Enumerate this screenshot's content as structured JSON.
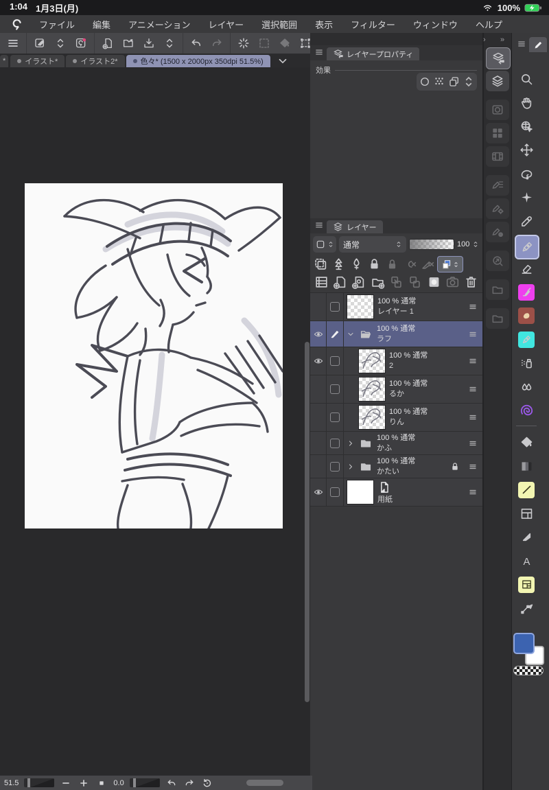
{
  "status_bar": {
    "time": "1:04",
    "date": "1月3日(月)",
    "battery_pct": "100%"
  },
  "menu_bar": {
    "items": [
      "ファイル",
      "編集",
      "アニメーション",
      "レイヤー",
      "選択範囲",
      "表示",
      "フィルター",
      "ウィンドウ",
      "ヘルプ"
    ]
  },
  "toolbar": {
    "groups": [
      [
        {
          "icon": "main-menu"
        }
      ],
      [
        {
          "icon": "edit-square"
        },
        {
          "icon": "chevron-updown"
        },
        {
          "icon": "clipstudio-badge"
        }
      ],
      [
        {
          "icon": "new-file"
        },
        {
          "icon": "open-folder"
        },
        {
          "icon": "save"
        },
        {
          "icon": "chevron-updown"
        }
      ],
      [
        {
          "icon": "undo"
        },
        {
          "icon": "redo",
          "dim": true
        }
      ],
      [
        {
          "icon": "spinner"
        },
        {
          "icon": "deselect",
          "dim": true
        },
        {
          "icon": "fill-diamond",
          "dim": true
        },
        {
          "icon": "transform-frame"
        }
      ]
    ],
    "collapse_icon": "chevron-down"
  },
  "tabs": {
    "leading_partial": "*",
    "items": [
      {
        "label": "イラスト*",
        "active": false
      },
      {
        "label": "イラスト2*",
        "active": false
      },
      {
        "label": "色々* (1500 x 2000px 350dpi 51.5%)",
        "active": true
      }
    ]
  },
  "layer_property_panel": {
    "tab_title": "レイヤープロパティ",
    "section_label": "効果",
    "effect_buttons": [
      "border-effect",
      "tone-effect",
      "layer-color-effect",
      "expand"
    ]
  },
  "layer_panel": {
    "tab_title": "レイヤー",
    "blend_mode": "通常",
    "opacity_value": "100",
    "header_icons": [
      "clip-thumbnail",
      "mask-area",
      "mask-pen",
      "lock",
      "lock-pixels",
      "clip-off",
      "ruler-off",
      "layer-color-on"
    ],
    "command_icons": [
      "layer-list",
      "new-layer",
      "new-vector-layer",
      "new-folder",
      "transfer-down",
      "merge-down",
      "layer-mask",
      "camera",
      "trash"
    ],
    "layers": [
      {
        "name": "レイヤー 1",
        "info": "100 % 通常",
        "kind": "layer",
        "thumb": "checker",
        "eye": false,
        "selected": false,
        "indent": 0
      },
      {
        "name": "ラフ",
        "info": "100 % 通常",
        "kind": "folder-open",
        "eye": true,
        "editing": true,
        "selected": true
      },
      {
        "name": "2",
        "info": "100 % 通常",
        "kind": "layer",
        "thumb": "sketch",
        "eye": true,
        "indent": 1
      },
      {
        "name": "るか",
        "info": "100 % 通常",
        "kind": "layer",
        "thumb": "sketch",
        "eye": false,
        "indent": 1
      },
      {
        "name": "りん",
        "info": "100 % 通常",
        "kind": "layer",
        "thumb": "sketch",
        "eye": false,
        "indent": 1
      },
      {
        "name": "かふ",
        "info": "100 % 通常",
        "kind": "folder",
        "eye": false
      },
      {
        "name": "かたい",
        "info": "100 % 通常",
        "kind": "folder",
        "eye": false,
        "locked": true
      },
      {
        "name": "用紙",
        "info": "",
        "kind": "paper",
        "thumb": "white",
        "eye": true
      }
    ]
  },
  "panel_strip": {
    "buttons": [
      {
        "icon": "layer-property",
        "active": true
      },
      {
        "icon": "layers"
      },
      {
        "icon": "navigator",
        "dim": true,
        "gap": true
      },
      {
        "icon": "materials",
        "dim": true
      },
      {
        "icon": "timeline",
        "dim": true
      },
      {
        "icon": "subtool-list",
        "dim": true,
        "gap": true
      },
      {
        "icon": "subtool-gear",
        "dim": true
      },
      {
        "icon": "subtool-detail",
        "dim": true
      },
      {
        "icon": "quick-access",
        "dim": true,
        "gap": true
      },
      {
        "icon": "folder-star",
        "dim": true,
        "gap": true
      },
      {
        "icon": "folder-download",
        "dim": true,
        "gap": true
      }
    ],
    "collapse_chevrons": [
      "›",
      "»",
      "»",
      "«"
    ]
  },
  "tool_strip": {
    "tools": [
      {
        "name": "zoom",
        "icon": "magnifier"
      },
      {
        "name": "hand",
        "icon": "hand"
      },
      {
        "name": "operation",
        "icon": "globe-cursor"
      },
      {
        "name": "move-layer",
        "icon": "move"
      },
      {
        "name": "selection",
        "icon": "lasso"
      },
      {
        "name": "auto-select",
        "icon": "wand"
      },
      {
        "name": "eyedropper",
        "icon": "eyedropper"
      },
      {
        "name": "pen",
        "icon": "pen-nib",
        "selected": true
      },
      {
        "name": "eraser",
        "icon": "eraser"
      },
      {
        "name": "brush",
        "icon": "brush",
        "tile": "#ee3fee"
      },
      {
        "name": "pastel",
        "icon": "pastel",
        "tile": "#9c5048"
      },
      {
        "name": "marker",
        "icon": "pen-nib",
        "tile": "#41e6e0"
      },
      {
        "name": "airbrush",
        "icon": "airbrush"
      },
      {
        "name": "blend",
        "icon": "drops"
      },
      {
        "name": "decoration",
        "icon": "spiral",
        "color": "#9a59e8"
      },
      {
        "divider": true
      },
      {
        "name": "fill",
        "icon": "fill-diamond"
      },
      {
        "name": "gradient",
        "icon": "gradient-tile"
      },
      {
        "name": "figure",
        "icon": "line-diag",
        "tile": "#f2f5b2"
      },
      {
        "name": "frame-border",
        "icon": "frame-panel"
      },
      {
        "name": "ruler",
        "icon": "flag"
      },
      {
        "name": "text",
        "icon": "letter-a"
      },
      {
        "name": "panel-material",
        "icon": "panel-grid",
        "tile": "#f2f5b2"
      },
      {
        "name": "line-correct",
        "icon": "line-fix"
      }
    ],
    "foreground_color": "#3c63b0",
    "background_color": "#ffffff"
  },
  "bottom_bar": {
    "zoom_value": "51.5",
    "rotation_value": "0.0",
    "icons": [
      "zoom-slider",
      "minus",
      "plus",
      "fit",
      "rotate-slider",
      "rotate-left",
      "rotate-right",
      "rotate-reset",
      "h-scrollbar"
    ]
  }
}
